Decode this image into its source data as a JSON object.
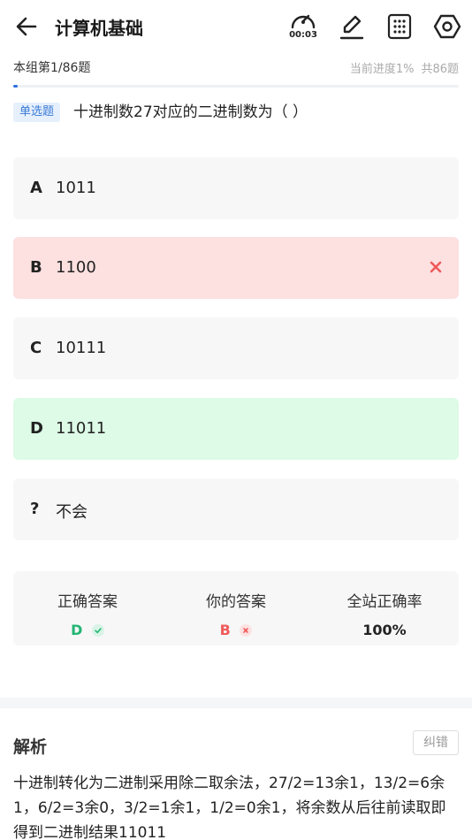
{
  "header": {
    "title": "计算机基础",
    "timer": "00:03"
  },
  "progress": {
    "group_label": "本组第1/86题",
    "current_progress": "当前进度1%",
    "total": "共86题",
    "percent": 1
  },
  "question": {
    "type": "单选题",
    "text": "十进制数27对应的二进制数为（ ）"
  },
  "options": [
    {
      "letter": "A",
      "text": "1011",
      "state": "normal"
    },
    {
      "letter": "B",
      "text": "1100",
      "state": "wrong"
    },
    {
      "letter": "C",
      "text": "10111",
      "state": "normal"
    },
    {
      "letter": "D",
      "text": "11011",
      "state": "correct"
    },
    {
      "letter": "?",
      "text": "不会",
      "state": "normal"
    }
  ],
  "stats": {
    "correct_label": "正确答案",
    "correct_value": "D",
    "yours_label": "你的答案",
    "yours_value": "B",
    "rate_label": "全站正确率",
    "rate_value": "100%"
  },
  "analysis": {
    "title": "解析",
    "report_label": "纠错",
    "body": "十进制转化为二进制采用除二取余法，27/2=13余1，13/2=6余1，6/2=3余0，3/2=1余1，1/2=0余1，将余数从后往前读取即得到二进制结果11011"
  },
  "colors": {
    "accent": "#2f6fe0",
    "correct": "#22b573",
    "wrong": "#f05a5a",
    "wrong_bg": "#fde0e0",
    "correct_bg": "#ddfbe6"
  }
}
